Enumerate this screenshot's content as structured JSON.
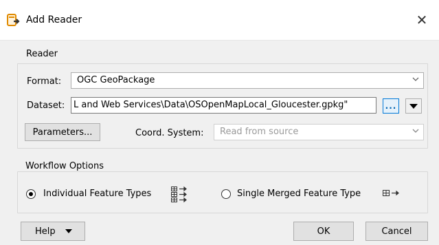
{
  "window": {
    "title": "Add Reader",
    "close_glyph": "✕",
    "icon": "add-reader-icon"
  },
  "reader_group": {
    "label": "Reader",
    "format_label": "Format:",
    "format_value": "OGC GeoPackage",
    "dataset_label": "Dataset:",
    "dataset_value": "L and Web Services\\Data\\OSOpenMapLocal_Gloucester.gpkg\"",
    "browse_label": "...",
    "parameters_label": "Parameters...",
    "coord_label": "Coord. System:",
    "coord_placeholder": "Read from source"
  },
  "workflow_group": {
    "label": "Workflow Options",
    "options": [
      {
        "label": "Individual Feature Types",
        "checked": true,
        "icon": "multiple-feature-types-icon"
      },
      {
        "label": "Single Merged Feature Type",
        "checked": false,
        "icon": "single-feature-type-icon"
      }
    ]
  },
  "footer": {
    "help_label": "Help",
    "ok_label": "OK",
    "cancel_label": "Cancel"
  }
}
